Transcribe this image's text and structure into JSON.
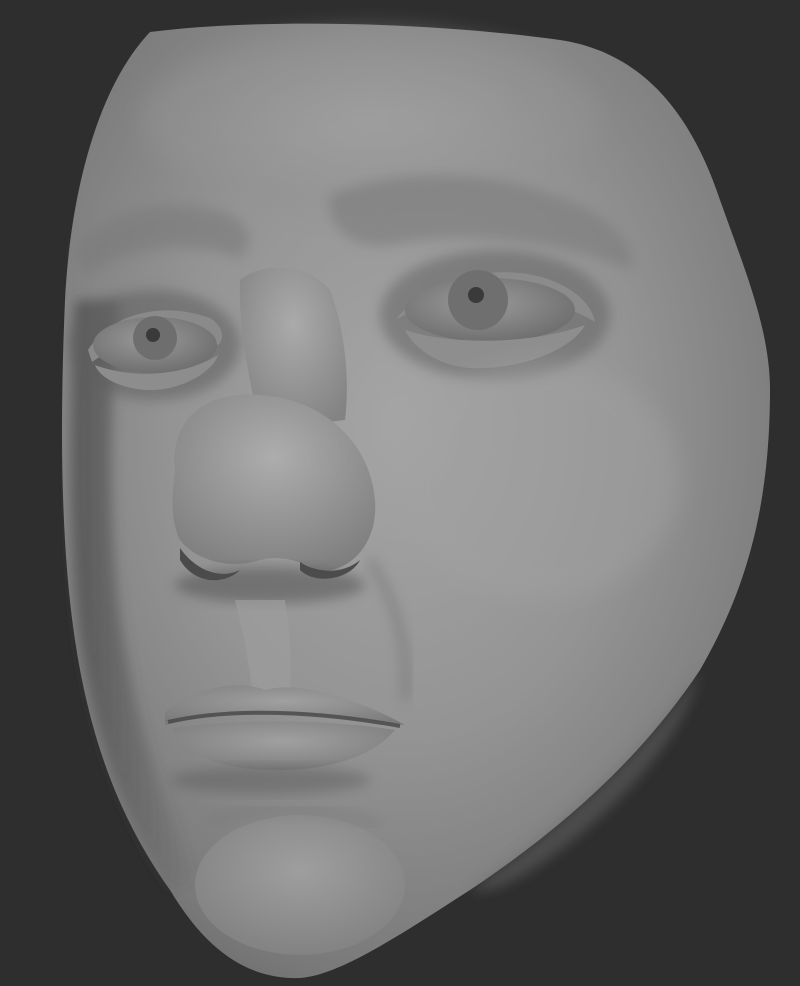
{
  "scene": {
    "background_color": "#2e2e2e",
    "subject": "clay-render-face-mask",
    "material_color": "#8e8e8e",
    "eye_color": "#7b7b7b",
    "pupil_color": "#3a3a3a",
    "shadow_color": "#353535"
  }
}
